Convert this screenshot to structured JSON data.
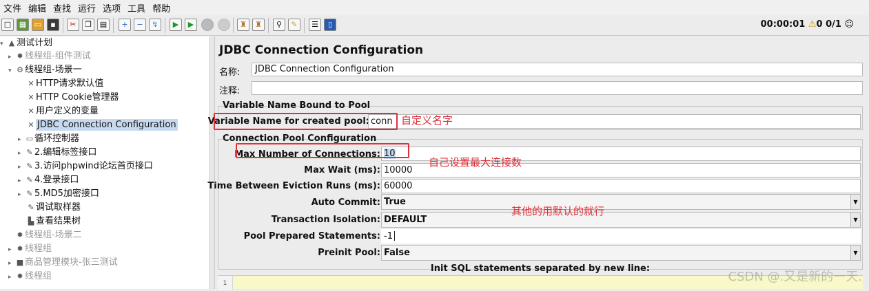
{
  "menu": [
    "文件",
    "编辑",
    "查找",
    "运行",
    "选项",
    "工具",
    "帮助"
  ],
  "toolbar": {
    "icons": [
      "new-icon",
      "templates-icon",
      "open-icon",
      "save-icon",
      "cut-icon",
      "copy-icon",
      "paste-icon",
      "expand-icon",
      "collapse-icon",
      "toggle-icon",
      "start-icon",
      "start-no-pause-icon",
      "stop-icon",
      "shutdown-icon",
      "clear-icon",
      "clear-all-icon",
      "search-icon",
      "reset-search-icon",
      "function-helper-icon",
      "help-icon"
    ],
    "timer": "00:00:01",
    "warning_count": "0",
    "threads": "0/1"
  },
  "tree": {
    "items": [
      {
        "label": "测试计划",
        "icon": "test-plan-icon"
      },
      {
        "label": "线程组-组件测试",
        "icon": "thread-group-icon"
      },
      {
        "label": "线程组-场景一",
        "icon": "thread-group-icon"
      },
      {
        "label": "HTTP请求默认值",
        "icon": "config-element-icon"
      },
      {
        "label": "HTTP Cookie管理器",
        "icon": "config-element-icon"
      },
      {
        "label": "用户定义的变量",
        "icon": "config-element-icon"
      },
      {
        "label": "JDBC Connection Configuration",
        "icon": "config-element-icon"
      },
      {
        "label": "循环控制器",
        "icon": "loop-controller-icon"
      },
      {
        "label": "2.编辑标签接口",
        "icon": "sampler-icon"
      },
      {
        "label": "3.访问phpwind论坛首页接口",
        "icon": "sampler-icon"
      },
      {
        "label": "4.登录接口",
        "icon": "sampler-icon"
      },
      {
        "label": "5.MD5加密接口",
        "icon": "sampler-icon"
      },
      {
        "label": "调试取样器",
        "icon": "sampler-icon"
      },
      {
        "label": "查看结果树",
        "icon": "listener-icon"
      },
      {
        "label": "线程组-场景二",
        "icon": "thread-group-icon"
      },
      {
        "label": "线程组",
        "icon": "thread-group-icon"
      },
      {
        "label": "商品管理模块-张三测试",
        "icon": "thread-group-icon"
      },
      {
        "label": "线程组",
        "icon": "thread-group-icon"
      }
    ]
  },
  "panel": {
    "title": "JDBC Connection Configuration",
    "name_label": "名称:",
    "name_value": "JDBC Connection Configuration",
    "comment_label": "注释:",
    "comment_value": "",
    "bound_section": "Variable Name Bound to Pool",
    "pool_var_label": "Variable Name for created pool:",
    "pool_var_value": "conn",
    "pool_section": "Connection Pool Configuration",
    "max_conn_label": "Max Number of Connections:",
    "max_conn_value": "10",
    "max_wait_label": "Max Wait (ms):",
    "max_wait_value": "10000",
    "eviction_label": "Time Between Eviction Runs (ms):",
    "eviction_value": "60000",
    "auto_commit_label": "Auto Commit:",
    "auto_commit_value": "True",
    "isolation_label": "Transaction Isolation:",
    "isolation_value": "DEFAULT",
    "prepared_label": "Pool Prepared Statements:",
    "prepared_value": "-1",
    "preinit_label": "Preinit Pool:",
    "preinit_value": "False",
    "init_sql_label": "Init SQL statements separated by new line:",
    "sql_line_number": "1"
  },
  "annotations": {
    "name_note": "自定义名字",
    "max_note": "自己设置最大连接数",
    "default_note": "其他的用默认的就行"
  },
  "watermark": "CSDN @.又是新的一天.",
  "colors": {
    "annotation_red": "#e0303a",
    "selection_blue": "#c7d9ef",
    "sql_yellow": "#f8f8c8"
  }
}
